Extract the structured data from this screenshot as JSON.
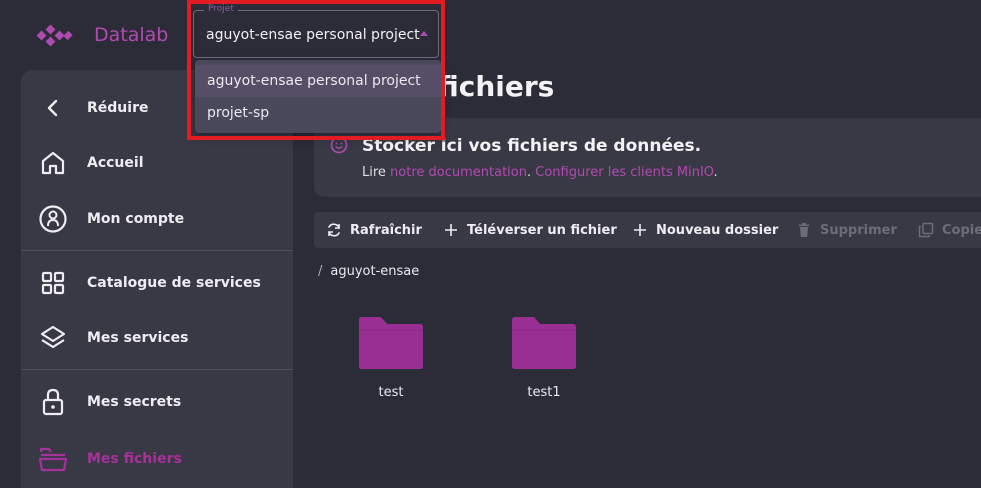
{
  "header": {
    "brand": "Datalab",
    "accent_color": "#b14ab0"
  },
  "project_selector": {
    "legend": "Projet",
    "value": "aguyot-ensae personal project",
    "options": [
      "aguyot-ensae personal project",
      "projet-sp"
    ],
    "highlight_color": "#e31b23"
  },
  "sidebar": {
    "items": [
      {
        "label": "Réduire",
        "icon": "chevron-left-icon"
      },
      {
        "label": "Accueil",
        "icon": "home-icon"
      },
      {
        "label": "Mon compte",
        "icon": "account-icon"
      },
      {
        "label": "Catalogue de services",
        "icon": "grid-icon"
      },
      {
        "label": "Mes services",
        "icon": "layers-icon"
      },
      {
        "label": "Mes secrets",
        "icon": "lock-icon"
      },
      {
        "label": "Mes fichiers",
        "icon": "folder-stack-icon"
      }
    ]
  },
  "main": {
    "title": "fichiers",
    "info": {
      "title": "Stocker ici vos fichiers de données.",
      "prefix": "Lire ",
      "doc_link": "notre documentation",
      "separator": ". ",
      "config_link": "Configurer les clients MinIO",
      "suffix": "."
    },
    "toolbar": {
      "refresh": "Rafraîchir",
      "upload": "Téléverser un fichier",
      "new_folder": "Nouveau dossier",
      "delete": "Supprimer",
      "copy": "Copie"
    },
    "breadcrumb": {
      "separator": "/",
      "path": "aguyot-ensae"
    },
    "folders": [
      {
        "name": "test"
      },
      {
        "name": "test1"
      }
    ]
  }
}
